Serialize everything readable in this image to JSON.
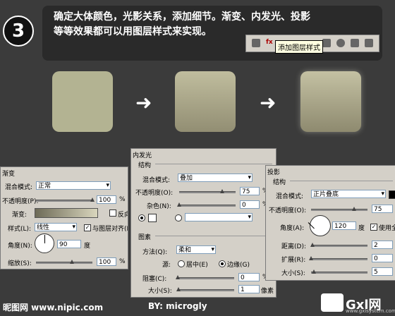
{
  "step": {
    "number": "3"
  },
  "instruction": {
    "line1": "确定大体颜色，光影关系，添加细节。渐变、内发光、投影",
    "line2": "等等效果都可以用图层样式来实现。"
  },
  "ps_toolbar": {
    "tooltip": "添加图层样式",
    "fx_label": "fx"
  },
  "tiles": {
    "arrow_icon": "right-arrow-icon",
    "colors": {
      "flat": "#b3b392",
      "gradient_top": "#c0bd9e",
      "gradient_bottom": "#928e73"
    }
  },
  "gradient_panel": {
    "title": "渐变",
    "blend_mode_label": "混合模式:",
    "blend_mode": "正常",
    "opacity_label": "不透明度(P):",
    "opacity": "100",
    "percent": "%",
    "gradient_label": "渐变:",
    "reverse_label": "反向(R)",
    "style_label": "样式(L):",
    "style": "线性",
    "align_label": "与图层对齐(I)",
    "angle_label": "角度(N):",
    "angle": "90",
    "degree_unit": "度",
    "scale_label": "缩放(S):",
    "scale": "100"
  },
  "inner_glow_panel": {
    "title": "内发光",
    "structure_label": "结构",
    "blend_mode_label": "混合模式:",
    "blend_mode": "叠加",
    "opacity_label": "不透明度(O):",
    "opacity": "75",
    "noise_label": "杂色(N):",
    "noise": "0",
    "percent": "%",
    "elements_label": "图素",
    "method_label": "方法(Q):",
    "method": "柔和",
    "source_label": "源:",
    "center_label": "居中(E)",
    "edge_label": "边缘(G)",
    "choke_label": "阻塞(C):",
    "choke": "0",
    "size_label": "大小(S):",
    "size": "1",
    "px_unit": "像素"
  },
  "drop_shadow_panel": {
    "title": "投影",
    "structure_label": "结构",
    "blend_mode_label": "混合模式:",
    "blend_mode": "正片叠底",
    "opacity_label": "不透明度(O):",
    "opacity": "75",
    "angle_label": "角度(A):",
    "angle": "120",
    "degree_unit": "度",
    "global_light_label": "使用全",
    "distance_label": "距离(D):",
    "distance": "2",
    "spread_label": "扩展(R):",
    "spread": "0",
    "size_label": "大小(S):",
    "size": "5"
  },
  "footer": {
    "left": "昵图网 www.nipic.com",
    "right": "BY: microgly",
    "logo": "Gxl网",
    "logo_sub": "www.gxlsystem.com"
  }
}
